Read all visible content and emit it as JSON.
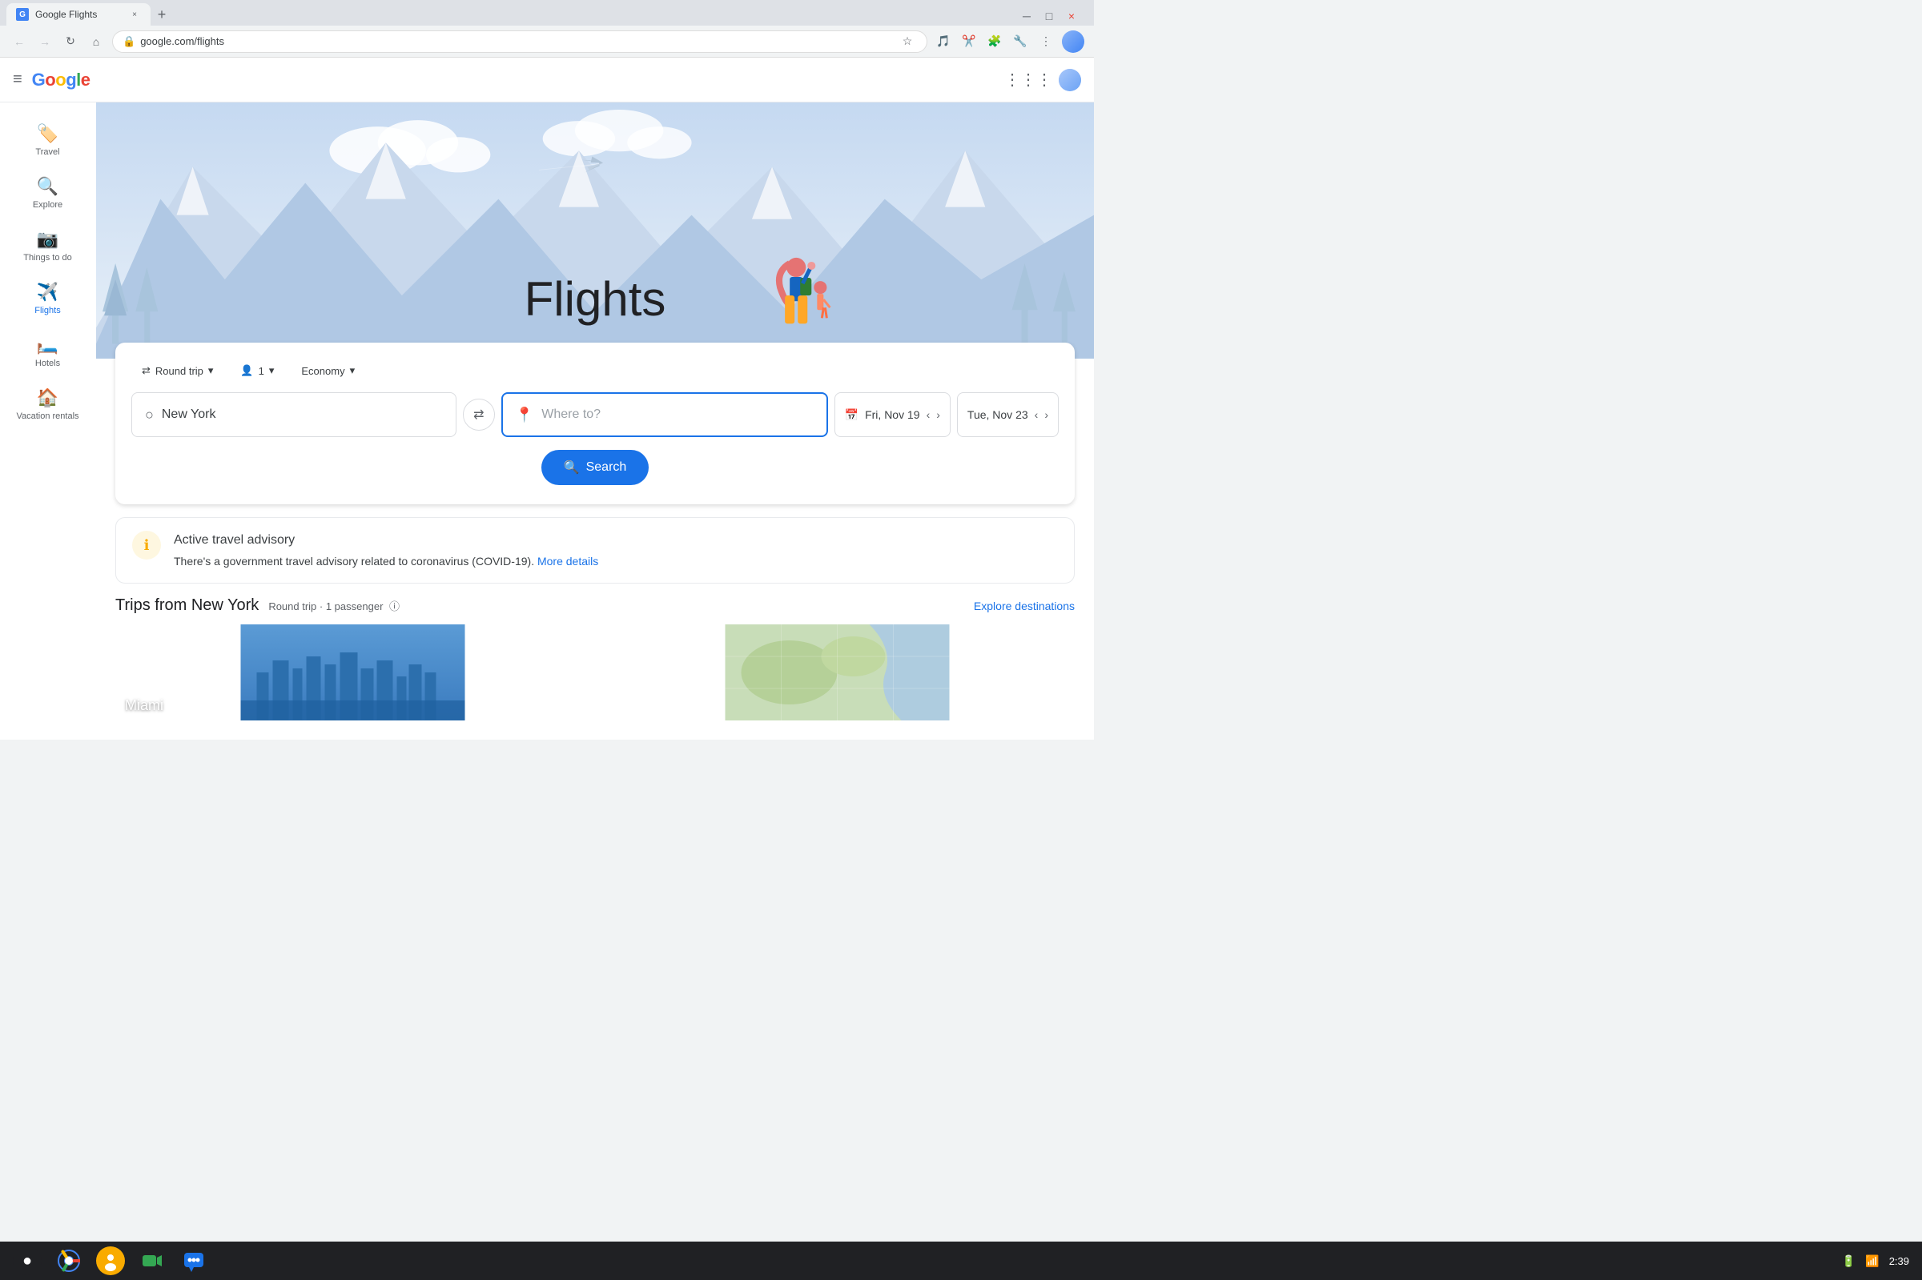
{
  "browser": {
    "tab_title": "Google Flights",
    "tab_favicon": "G",
    "url": "google.com/flights",
    "close_icon": "×",
    "add_tab_icon": "+",
    "back_icon": "←",
    "forward_icon": "→",
    "reload_icon": "↻",
    "home_icon": "⌂",
    "star_icon": "☆",
    "menu_icon": "⋮",
    "window_min": "─",
    "window_max": "□",
    "window_close": "×"
  },
  "header": {
    "hamburger_icon": "≡",
    "google_logo": "Google",
    "apps_icon": "⋮⋮⋮",
    "colors": {
      "blue": "#4285f4",
      "red": "#ea4335",
      "yellow": "#fbbc05",
      "green": "#34a853"
    }
  },
  "sidebar": {
    "items": [
      {
        "id": "travel",
        "label": "Travel",
        "icon": "🏷️",
        "active": false
      },
      {
        "id": "explore",
        "label": "Explore",
        "icon": "🔍",
        "active": false
      },
      {
        "id": "things-to-do",
        "label": "Things to do",
        "icon": "📷",
        "active": false
      },
      {
        "id": "flights",
        "label": "Flights",
        "icon": "✈️",
        "active": true
      },
      {
        "id": "hotels",
        "label": "Hotels",
        "icon": "🛏️",
        "active": false
      },
      {
        "id": "vacation-rentals",
        "label": "Vacation rentals",
        "icon": "🏠",
        "active": false
      }
    ]
  },
  "hero": {
    "title": "Flights"
  },
  "search": {
    "trip_type_label": "Round trip",
    "passengers_label": "1",
    "class_label": "Economy",
    "origin_value": "New York",
    "destination_placeholder": "Where to?",
    "date_depart": "Fri, Nov 19",
    "date_return": "Tue, Nov 23",
    "search_button_label": "Search",
    "chevron_down": "▾",
    "swap_icon": "⇄",
    "calendar_icon": "📅",
    "location_icon": "📍",
    "origin_icon": "○",
    "passenger_icon": "👤",
    "nav_prev": "‹",
    "nav_next": "›"
  },
  "advisory": {
    "icon": "ℹ",
    "title": "Active travel advisory",
    "text": "There's a government travel advisory related to coronavirus (COVID-19).",
    "link_text": "More details",
    "link_url": "#"
  },
  "trips": {
    "title": "Trips from New York",
    "meta": "Round trip · 1 passenger",
    "info_icon": "ⓘ",
    "explore_link": "Explore destinations",
    "cards": [
      {
        "id": "miami",
        "label": "Miami",
        "color_start": "#4a90d9",
        "color_end": "#87c1f0"
      },
      {
        "id": "map",
        "label": "",
        "color_start": "#b8d4a8",
        "color_end": "#7aad6a"
      }
    ]
  },
  "taskbar": {
    "icons": [
      "chrome",
      "circle",
      "video",
      "chat"
    ],
    "time": "2:39",
    "circle_icon": "●",
    "wifi_icon": "WiFi",
    "battery_icon": "🔋"
  }
}
